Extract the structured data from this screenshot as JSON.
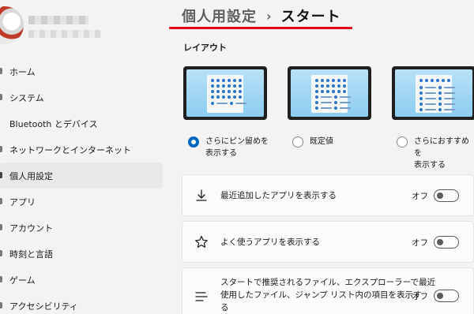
{
  "sidebar": {
    "items": [
      {
        "label": "ホーム"
      },
      {
        "label": "システム"
      },
      {
        "label": "Bluetooth とデバイス"
      },
      {
        "label": "ネットワークとインターネット"
      },
      {
        "label": "個人用設定",
        "active": true
      },
      {
        "label": "アプリ"
      },
      {
        "label": "アカウント"
      },
      {
        "label": "時刻と言語"
      },
      {
        "label": "ゲーム"
      },
      {
        "label": "アクセシビリティ"
      }
    ]
  },
  "header": {
    "breadcrumb_parent": "個人用設定",
    "separator": "›",
    "current": "スタート",
    "underline_color": "#e0001b"
  },
  "layout": {
    "section_label": "レイアウト",
    "options": [
      {
        "label_line1": "さらにピン留めを",
        "label_line2": "表示する",
        "selected": true,
        "icon": "more-pins-layout"
      },
      {
        "label_line1": "既定値",
        "label_line2": "",
        "selected": false,
        "icon": "default-layout"
      },
      {
        "label_line1": "さらにおすすめを",
        "label_line2": "表示する",
        "selected": false,
        "icon": "more-recommendations-layout"
      }
    ]
  },
  "settings": [
    {
      "icon": "download-icon",
      "text_line1": "最近追加したアプリを表示する",
      "text_line2": "",
      "state_label": "オフ",
      "on": false
    },
    {
      "icon": "star-icon",
      "text_line1": "よく使うアプリを表示する",
      "text_line2": "",
      "state_label": "オフ",
      "on": false
    },
    {
      "icon": "list-icon",
      "text_line1": "スタートで推奨されるファイル、エクスプローラーで最近",
      "text_line2": "使用したファイル、ジャンプ リスト内の項目を表示す",
      "text_line3": "る",
      "state_label": "オフ",
      "on": false
    }
  ],
  "colors": {
    "accent": "#0067c0",
    "background": "#f3f3f3"
  }
}
